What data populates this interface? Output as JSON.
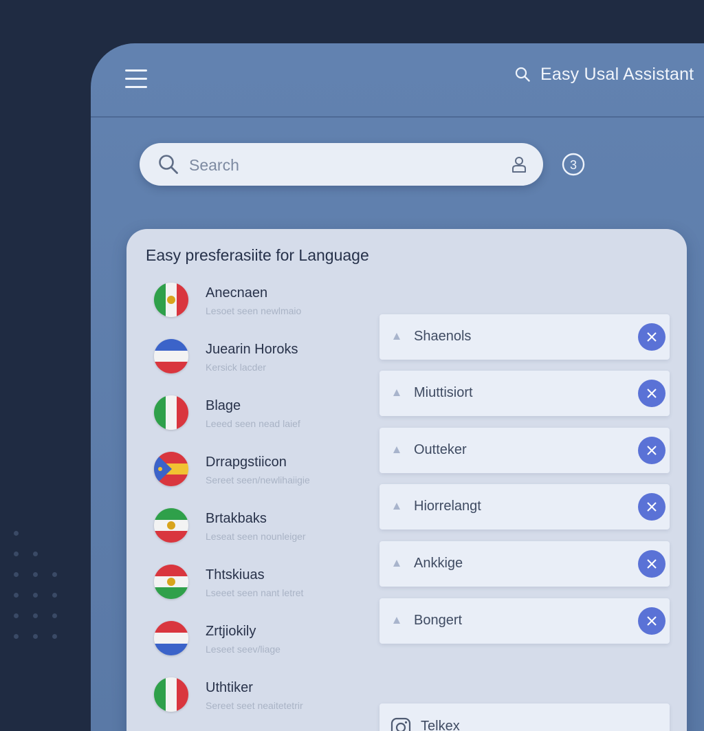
{
  "header": {
    "title": "Easy Usal Assistant"
  },
  "search": {
    "placeholder": "Search"
  },
  "panel": {
    "title": "Easy presferasiite for Language"
  },
  "languages": [
    {
      "name": "Anecnaen",
      "subtitle": "Lesoet seen newlmaio",
      "flag": "green-white-red-emblem"
    },
    {
      "name": "Juearin Horoks",
      "subtitle": "Kersick lacder",
      "flag": "blue-white-red"
    },
    {
      "name": "Blage",
      "subtitle": "Leeed seen nead laief",
      "flag": "green-white-red"
    },
    {
      "name": "Drrapgstiicon",
      "subtitle": "Sereet seen/newlihaiigie",
      "flag": "red-yellow-blue-triangle"
    },
    {
      "name": "Brtakbaks",
      "subtitle": "Leseat seen nounleiger",
      "flag": "green-white-red-emblem"
    },
    {
      "name": "Thtskiuas",
      "subtitle": "Lseeet seen nant letret",
      "flag": "red-white-green-emblem"
    },
    {
      "name": "Zrtjiokily",
      "subtitle": "Leseet seev/liage",
      "flag": "red-white-blue"
    },
    {
      "name": "Uthtiker",
      "subtitle": "Sereet seet neaitetetrir",
      "flag": "green-white-red"
    }
  ],
  "selected": [
    {
      "label": "Shaenols"
    },
    {
      "label": "Miuttisiort"
    },
    {
      "label": "Outteker"
    },
    {
      "label": "Hiorrelangt"
    },
    {
      "label": "Ankkige"
    },
    {
      "label": "Bongert"
    }
  ],
  "extra": {
    "label": "Telkex",
    "icon": "instagram-icon"
  },
  "colors": {
    "background": "#1f2b42",
    "app_surface": "#6282b0",
    "panel": "#d5dcea",
    "accent": "#5a72d6"
  }
}
